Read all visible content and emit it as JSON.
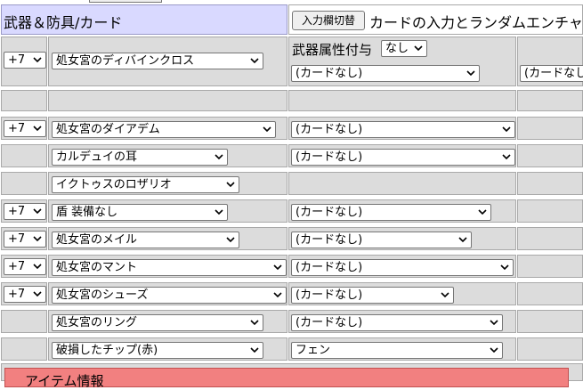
{
  "header": {
    "title": "武器＆防具/カード",
    "toggle_button": "入力欄切替",
    "card_random_title": "カードの入力とランダムエンチャ"
  },
  "weapon": {
    "refine": "+7",
    "name": "処女宮のディバインクロス",
    "attribute_label": "武器属性付与",
    "attribute_value": "なし",
    "card1": "(カードなし)",
    "card2": "(カードなし"
  },
  "equipment": [
    {
      "refine": "+7",
      "name": "処女宮のダイアデム",
      "card": "(カードなし)"
    },
    {
      "refine": "",
      "name": "カルデュイの耳",
      "card": "(カードなし)"
    },
    {
      "refine": "",
      "name": "イクトゥスのロザリオ",
      "card": ""
    },
    {
      "refine": "+7",
      "name": "盾 装備なし",
      "card": "(カードなし)"
    },
    {
      "refine": "+7",
      "name": "処女宮のメイル",
      "card": "(カードなし)"
    },
    {
      "refine": "+7",
      "name": "処女宮のマント",
      "card": "(カードなし)"
    },
    {
      "refine": "+7",
      "name": "処女宮のシューズ",
      "card": "(カードなし)"
    },
    {
      "refine": "",
      "name": "処女宮のリング",
      "card": "(カードなし)"
    },
    {
      "refine": "",
      "name": "破損したチップ(赤)",
      "card": "フェン"
    }
  ],
  "item_info": {
    "label": "アイテム情報"
  }
}
